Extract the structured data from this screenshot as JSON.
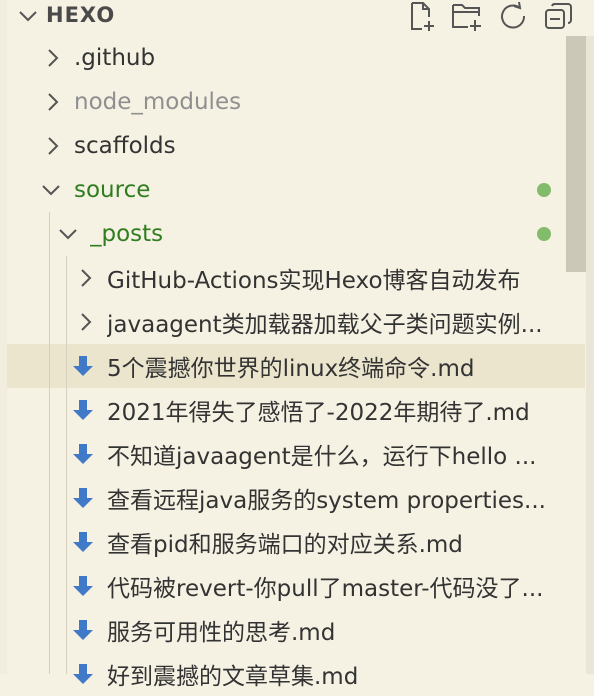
{
  "header": {
    "title": "HEXO",
    "actions": [
      "new-file-icon",
      "new-folder-icon",
      "refresh-icon",
      "collapse-all-icon"
    ]
  },
  "colors": {
    "background": "#f5f1e3",
    "selected": "#ebe5ce",
    "folder_modified": "#2f7d1f",
    "dot": "#82bb6a",
    "ignored": "#8f8f8f",
    "arrow": "#3f79c7"
  },
  "tree": {
    "items": [
      {
        "label": ".github",
        "expanded": false,
        "type": "folder"
      },
      {
        "label": "node_modules",
        "expanded": false,
        "type": "folder",
        "ignored": true
      },
      {
        "label": "scaffolds",
        "expanded": false,
        "type": "folder"
      },
      {
        "label": "source",
        "expanded": true,
        "type": "folder",
        "modified": true
      },
      {
        "label": "_posts",
        "expanded": true,
        "type": "folder",
        "modified": true
      },
      {
        "label": "GitHub-Actions实现Hexo博客自动发布",
        "expanded": false,
        "type": "folder"
      },
      {
        "label": "javaagent类加载器加载父子类问题实例...",
        "expanded": false,
        "type": "folder"
      },
      {
        "label": "5个震撼你世界的linux终端命令.md",
        "type": "file",
        "selected": true
      },
      {
        "label": "2021年得失了感悟了-2022年期待了.md",
        "type": "file"
      },
      {
        "label": "不知道javaagent是什么，运行下hello ...",
        "type": "file"
      },
      {
        "label": "查看远程java服务的system properties...",
        "type": "file"
      },
      {
        "label": "查看pid和服务端口的对应关系.md",
        "type": "file"
      },
      {
        "label": "代码被revert-你pull了master-代码没了...",
        "type": "file"
      },
      {
        "label": "服务可用性的思考.md",
        "type": "file"
      },
      {
        "label": "好到震撼的文章草集.md",
        "type": "file"
      }
    ]
  }
}
